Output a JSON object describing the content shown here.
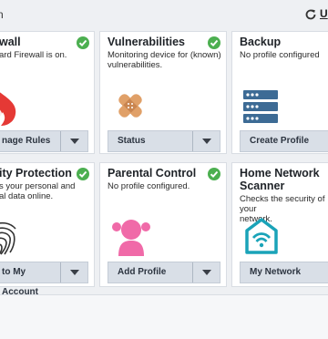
{
  "topbar": {
    "left_text": "n",
    "update_text": "U",
    "refresh_icon": "refresh-icon"
  },
  "tiles": [
    {
      "title": "wall",
      "desc_lines": [
        "ard Firewall is on."
      ],
      "button": "nage Rules",
      "status": "ok",
      "icon": "flame-icon"
    },
    {
      "title": "Vulnerabilities",
      "desc_lines": [
        "Monitoring device for (known)",
        "vulnerabilities."
      ],
      "button": "Status",
      "status": "ok",
      "icon": "bandage-icon"
    },
    {
      "title": "Backup",
      "desc_lines": [
        "No profile configured"
      ],
      "button": "Create Profile",
      "status": "",
      "icon": "server-icon"
    },
    {
      "title": "ity Protection",
      "desc_lines": [
        "s your personal and",
        "al data online."
      ],
      "button": "to My Account",
      "status": "ok",
      "icon": "fingerprint-icon"
    },
    {
      "title": "Parental Control",
      "desc_lines": [
        "No profile configured."
      ],
      "button": "Add Profile",
      "status": "ok",
      "icon": "child-icon"
    },
    {
      "title": "Home Network",
      "title2": "Scanner",
      "desc_lines": [
        "Checks the security of your",
        "network."
      ],
      "button": "My Network",
      "status": "",
      "icon": "home-wifi-icon"
    }
  ],
  "colors": {
    "accent_green": "#4caf50",
    "flame_red": "#e53935",
    "bandage": "#e0a068",
    "server_blue": "#3d6b95",
    "child_pink": "#f06aa8",
    "home_teal": "#1aa3b8"
  }
}
